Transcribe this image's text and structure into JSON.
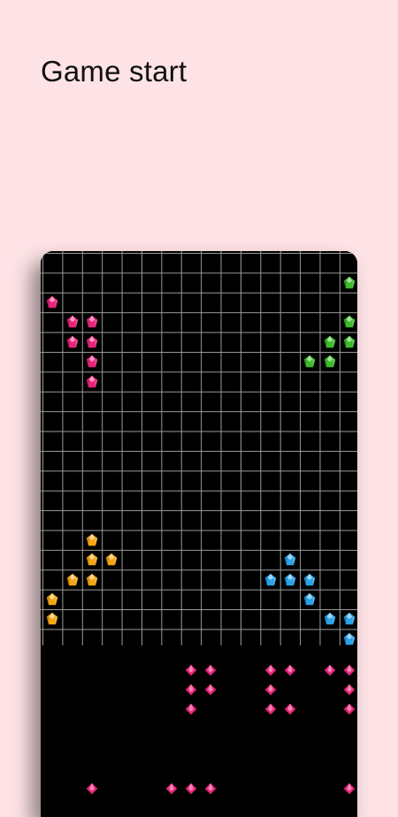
{
  "caption": "Game start",
  "colors": {
    "background": "#fde3e6",
    "pink": "#e8237a",
    "green": "#3dbb2a",
    "orange": "#f5a512",
    "blue": "#2aa2e8"
  },
  "board": {
    "cols": 16,
    "rows": 20,
    "pieces": [
      {
        "name": "pink-piece",
        "color": "pink",
        "cells": [
          [
            0,
            2
          ],
          [
            1,
            3
          ],
          [
            1,
            4
          ],
          [
            2,
            3
          ],
          [
            2,
            4
          ],
          [
            2,
            5
          ],
          [
            2,
            6
          ]
        ]
      },
      {
        "name": "green-piece",
        "color": "green",
        "cells": [
          [
            15,
            1
          ],
          [
            15,
            3
          ],
          [
            14,
            4
          ],
          [
            15,
            4
          ],
          [
            13,
            5
          ],
          [
            14,
            5
          ]
        ]
      },
      {
        "name": "orange-piece",
        "color": "orange",
        "cells": [
          [
            2,
            14
          ],
          [
            2,
            15
          ],
          [
            3,
            15
          ],
          [
            1,
            16
          ],
          [
            2,
            16
          ],
          [
            0,
            17
          ],
          [
            0,
            18
          ]
        ]
      },
      {
        "name": "blue-piece",
        "color": "blue",
        "cells": [
          [
            12,
            15
          ],
          [
            11,
            16
          ],
          [
            12,
            16
          ],
          [
            13,
            16
          ],
          [
            13,
            17
          ],
          [
            14,
            18
          ],
          [
            15,
            18
          ],
          [
            15,
            19
          ]
        ]
      }
    ]
  },
  "tray_gems": {
    "color": "pink",
    "cells": [
      [
        7,
        1
      ],
      [
        8,
        1
      ],
      [
        7,
        2
      ],
      [
        8,
        2
      ],
      [
        7,
        3
      ],
      [
        11,
        1
      ],
      [
        12,
        1
      ],
      [
        11,
        2
      ],
      [
        11,
        3
      ],
      [
        12,
        3
      ],
      [
        14,
        1
      ],
      [
        15,
        1
      ],
      [
        15,
        2
      ],
      [
        15,
        3
      ],
      [
        2,
        7
      ],
      [
        6,
        7
      ],
      [
        7,
        7
      ],
      [
        8,
        7
      ],
      [
        15,
        7
      ]
    ]
  }
}
